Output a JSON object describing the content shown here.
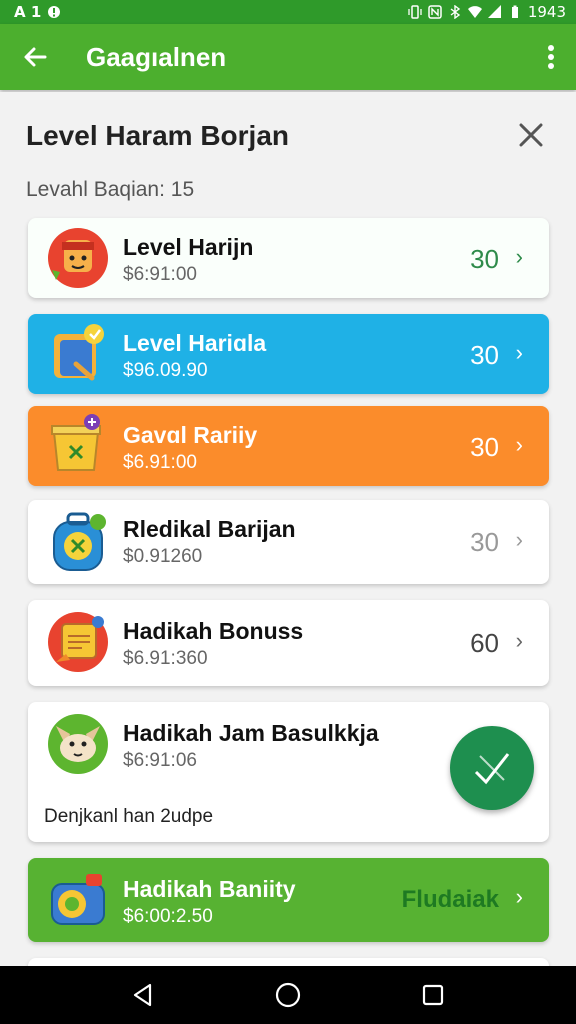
{
  "status_bar": {
    "left_glyphs": "A 1",
    "time": "1943",
    "icons": [
      "alert-icon",
      "info-icon",
      "vibrate-icon",
      "nfc-icon",
      "bluetooth-icon",
      "wifi-icon",
      "signal-icon",
      "battery-icon"
    ]
  },
  "app_bar": {
    "title": "Gaagıalnen",
    "back_icon": "arrow-left-icon",
    "menu_icon": "more-vert-icon",
    "color": "#4caf2e"
  },
  "sheet": {
    "title": "Level Haram Borjan",
    "subtitle": "Levahl Baqian:  15",
    "close_icon": "close-icon"
  },
  "items": [
    {
      "name": "Level Harijn",
      "price": "$6:91:00",
      "value": "30",
      "icon": "red-face-icon",
      "bg": "#fafffb"
    },
    {
      "name": "Level Hariɑla",
      "price": "$96.09.90",
      "value": "30",
      "icon": "blue-clipboard-icon",
      "bg": "#1fb1e6"
    },
    {
      "name": "Gavɑl Rariiy",
      "price": "$6.91:00",
      "value": "30",
      "icon": "yellow-box-icon",
      "bg": "#fb8c2b"
    },
    {
      "name": "Rledikal Barijan",
      "price": "$0.91260",
      "value": "30",
      "icon": "blue-backpack-icon",
      "bg": "#ffffff"
    },
    {
      "name": "Hadikah Bonuss",
      "price": "$6.91:360",
      "value": "60",
      "icon": "orange-note-icon",
      "bg": "#ffffff"
    },
    {
      "name": "Hadikah Jam Basulkkja",
      "price": "$6:91:06",
      "icon": "dog-face-icon",
      "note": "Denjkanl han 2udpe",
      "action_icon": "checkmark-icon",
      "bg": "#ffffff"
    },
    {
      "name": "Hadikah Baniity",
      "price": "$6:00:2.50",
      "value": "Fludaiak",
      "icon": "green-camera-icon",
      "bg": "#57b232"
    }
  ],
  "nav_bar": {
    "back": "nav-back-icon",
    "home": "nav-home-icon",
    "recents": "nav-recents-icon"
  }
}
